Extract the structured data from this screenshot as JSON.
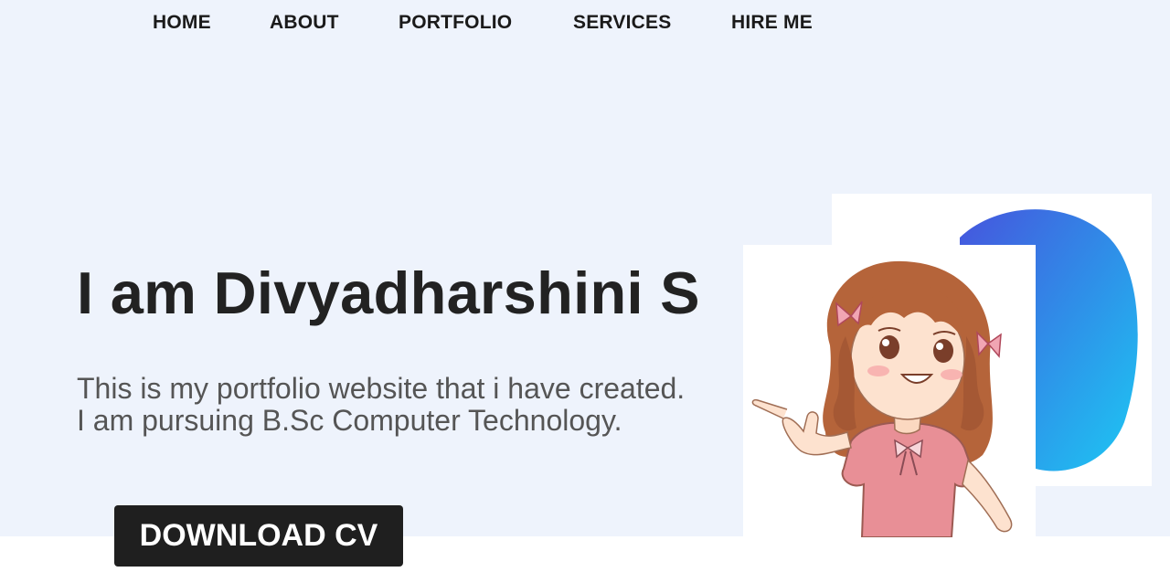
{
  "nav": {
    "items": [
      {
        "label": "HOME"
      },
      {
        "label": "ABOUT"
      },
      {
        "label": "PORTFOLIO"
      },
      {
        "label": "SERVICES"
      },
      {
        "label": "HIRE ME"
      }
    ]
  },
  "hero": {
    "title": "I am Divyadharshini S",
    "description_line1": "This is my portfolio website that i have created.",
    "description_line2": "I am pursuing B.Sc Computer Technology.",
    "button_label": "DOWNLOAD CV"
  },
  "colors": {
    "hero_background": "#eef3fc",
    "button_background": "#1f1f1f",
    "blob_gradient_start": "#3f5fe0",
    "blob_gradient_end": "#20c6f2",
    "dress": "#e88f96",
    "hair": "#b5643a"
  },
  "images": {
    "portrait": "cartoon-girl-pointing",
    "backdrop": "blue-gradient-blob"
  }
}
